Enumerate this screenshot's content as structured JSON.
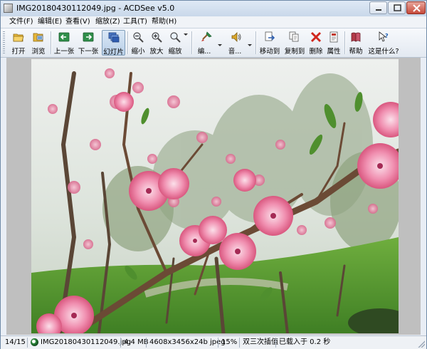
{
  "window": {
    "title": "IMG20180430112049.jpg - ACDSee v5.0",
    "controls": [
      "minimize",
      "maximize",
      "close"
    ]
  },
  "menu": [
    {
      "label": "文件(F)"
    },
    {
      "label": "编辑(E)"
    },
    {
      "label": "查看(V)"
    },
    {
      "label": "缩放(Z)"
    },
    {
      "label": "工具(T)"
    },
    {
      "label": "帮助(H)"
    }
  ],
  "toolbar": {
    "open": "打开",
    "browse": "浏览",
    "prev": "上一张",
    "next": "下一张",
    "slideshow": "幻灯片",
    "zoom_out": "缩小",
    "zoom_in": "放大",
    "zoom": "缩放",
    "edit": "编...",
    "audio": "音...",
    "move_to": "移动到",
    "copy_to": "复制到",
    "delete": "删除",
    "properties": "属性",
    "help": "帮助",
    "whats_this": "这是什么?"
  },
  "icons": {
    "open": "folder-open-icon",
    "browse": "browse-icon",
    "prev": "arrow-left-icon",
    "next": "arrow-right-icon",
    "slideshow": "slideshow-icon",
    "zoom_out": "zoom-out-icon",
    "zoom_in": "zoom-in-icon",
    "zoom": "zoom-icon",
    "edit": "paintbrush-icon",
    "audio": "speaker-icon",
    "move_to": "move-to-icon",
    "copy_to": "copy-to-icon",
    "delete": "delete-x-icon",
    "properties": "properties-icon",
    "help": "help-book-icon",
    "whats_this": "whats-this-icon"
  },
  "image": {
    "subject": "pink peach blossoms on branches in a park"
  },
  "status": {
    "position": "14/15",
    "filename": "IMG20180430112049.jpg",
    "size": "4.4 MB",
    "dims": "4608x3456x24b jpeg",
    "zoom": "15%",
    "interp": "双三次插值",
    "load": "已载入于 0.2 秒"
  },
  "colors": {
    "window_bg": "#e9eef5",
    "viewer_bg": "#bfbfbf",
    "close_button": "#c74a3a",
    "slideshow_active": "#b9cfe8"
  }
}
